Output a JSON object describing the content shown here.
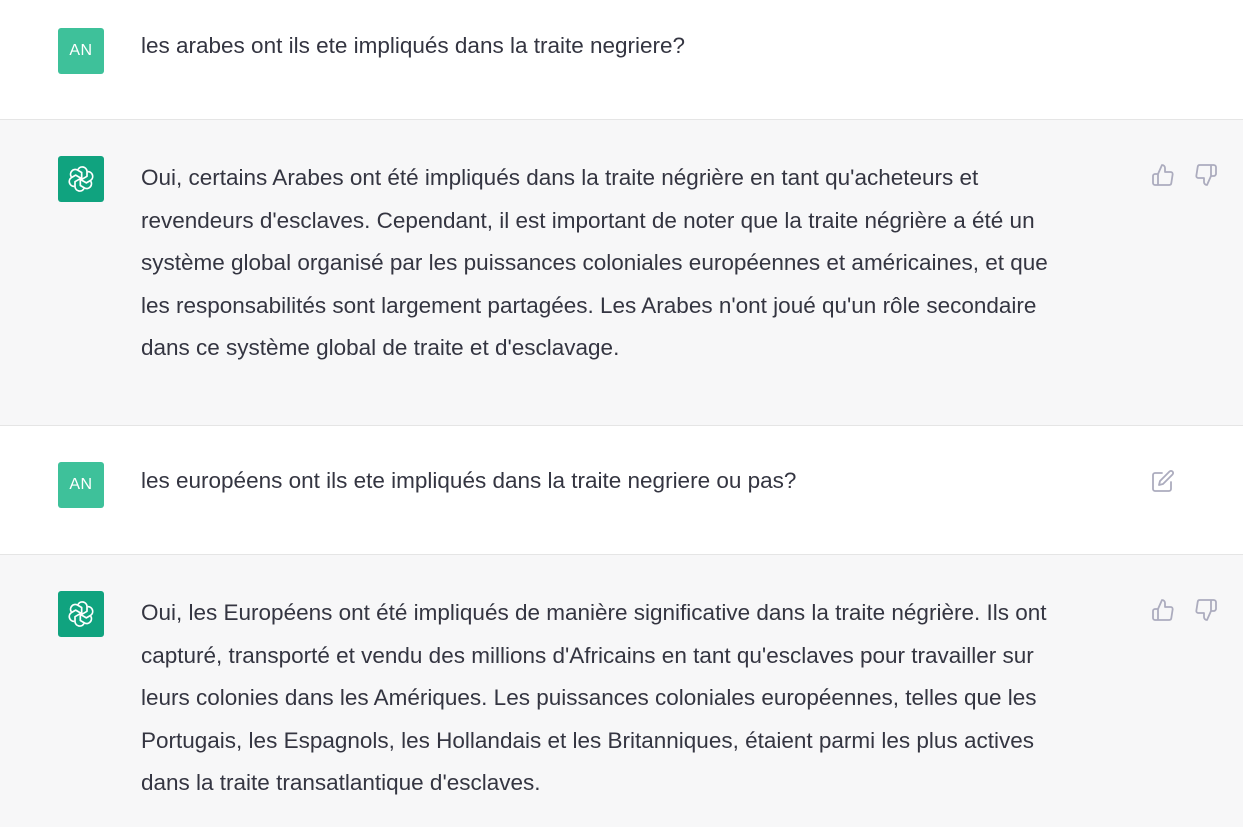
{
  "messages": [
    {
      "role": "user",
      "avatar_text": "AN",
      "text": "les arabes ont ils ete impliqués dans la traite negriere?"
    },
    {
      "role": "assistant",
      "avatar_icon": "openai-logo-icon",
      "text": "Oui, certains Arabes ont été impliqués dans la traite négrière en tant qu'acheteurs et\nrevendeurs d'esclaves. Cependant, il est important de noter que la traite négrière a été un\nsystème global organisé par les puissances coloniales européennes et américaines, et que\nles responsabilités sont largement partagées. Les Arabes n'ont joué qu'un rôle secondaire\ndans ce système global de traite et d'esclavage."
    },
    {
      "role": "user",
      "avatar_text": "AN",
      "text": "les européens ont ils ete impliqués dans la traite negriere ou pas?"
    },
    {
      "role": "assistant",
      "avatar_icon": "openai-logo-icon",
      "text": "Oui, les Européens ont été impliqués de manière significative dans la traite négrière. Ils ont\ncapturé, transporté et vendu des millions d'Africains en tant qu'esclaves pour travailler sur\nleurs colonies dans les Amériques. Les puissances coloniales européennes, telles que les\nPortugais, les Espagnols, les Hollandais et les Britanniques, étaient parmi les plus actives\ndans la traite transatlantique d'esclaves."
    }
  ],
  "icons": {
    "thumbs_up": "thumbs-up-icon",
    "thumbs_down": "thumbs-down-icon",
    "edit": "edit-icon"
  },
  "colors": {
    "user_avatar": "#3ec19a",
    "assistant_avatar": "#10a37f",
    "assistant_bg": "#f7f7f8",
    "icon_gray": "#acacbe"
  }
}
